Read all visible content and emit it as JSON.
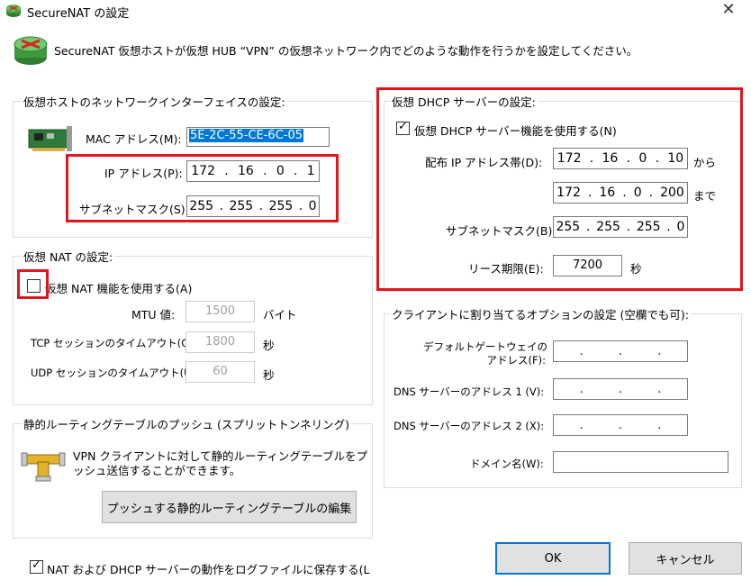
{
  "window": {
    "title": "SecureNAT の設定",
    "close_glyph": "✕"
  },
  "header": {
    "description": "SecureNAT 仮想ホストが仮想 HUB “VPN” の仮想ネットワーク内でどのような動作を行うかを設定してください。",
    "icon": "router-icon"
  },
  "virtual_host": {
    "title": "仮想ホストのネットワークインターフェイスの設定:",
    "mac_label": "MAC アドレス(M):",
    "mac_value": "5E-2C-55-CE-6C-05",
    "ip_label": "IP アドレス(P):",
    "ip": [
      "172",
      "16",
      "0",
      "1"
    ],
    "mask_label": "サブネットマスク(S):",
    "mask": [
      "255",
      "255",
      "255",
      "0"
    ]
  },
  "nat": {
    "title": "仮想 NAT の設定:",
    "enable_label": "仮想 NAT 機能を使用する(A)",
    "enabled": false,
    "mtu_label": "MTU 値:",
    "mtu_value": "1500",
    "mtu_unit": "バイト",
    "tcp_label": "TCP セッションのタイムアウト(C):",
    "tcp_value": "1800",
    "tcp_unit": "秒",
    "udp_label": "UDP セッションのタイムアウト(U):",
    "udp_value": "60",
    "udp_unit": "秒"
  },
  "routing": {
    "title": "静的ルーティングテーブルのプッシュ (スプリットトンネリング)",
    "desc_line1": "VPN クライアントに対して静的ルーティングテーブルをプ",
    "desc_line2": "ッシュ送信することができます。",
    "edit_button": "プッシュする静的ルーティングテーブルの編集"
  },
  "dhcp": {
    "title": "仮想 DHCP サーバーの設定:",
    "enable_label": "仮想 DHCP サーバー機能を使用する(N)",
    "enabled": true,
    "range_label": "配布 IP アドレス帯(D):",
    "range_start": [
      "172",
      "16",
      "0",
      "10"
    ],
    "from_text": "から",
    "range_end": [
      "172",
      "16",
      "0",
      "200"
    ],
    "to_text": "まで",
    "mask_label": "サブネットマスク(B):",
    "mask": [
      "255",
      "255",
      "255",
      "0"
    ],
    "lease_label": "リース期限(E):",
    "lease_value": "7200",
    "lease_unit": "秒"
  },
  "client_options": {
    "title": "クライアントに割り当てるオプションの設定 (空欄でも可):",
    "gateway_label_1": "デフォルトゲートウェイの",
    "gateway_label_2": "アドレス(F):",
    "dns1_label": "DNS サーバーのアドレス 1 (V):",
    "dns2_label": "DNS サーバーのアドレス 2 (X):",
    "domain_label": "ドメイン名(W):",
    "domain_value": ""
  },
  "footer": {
    "log_label": "NAT および DHCP サーバーの動作をログファイルに保存する(L",
    "log_enabled": true,
    "ok_label": "OK",
    "cancel_label": "キャンセル"
  },
  "colors": {
    "highlight_box": "#e0161e",
    "selection": "#0078d7",
    "group_border": "#dcdcdc"
  }
}
